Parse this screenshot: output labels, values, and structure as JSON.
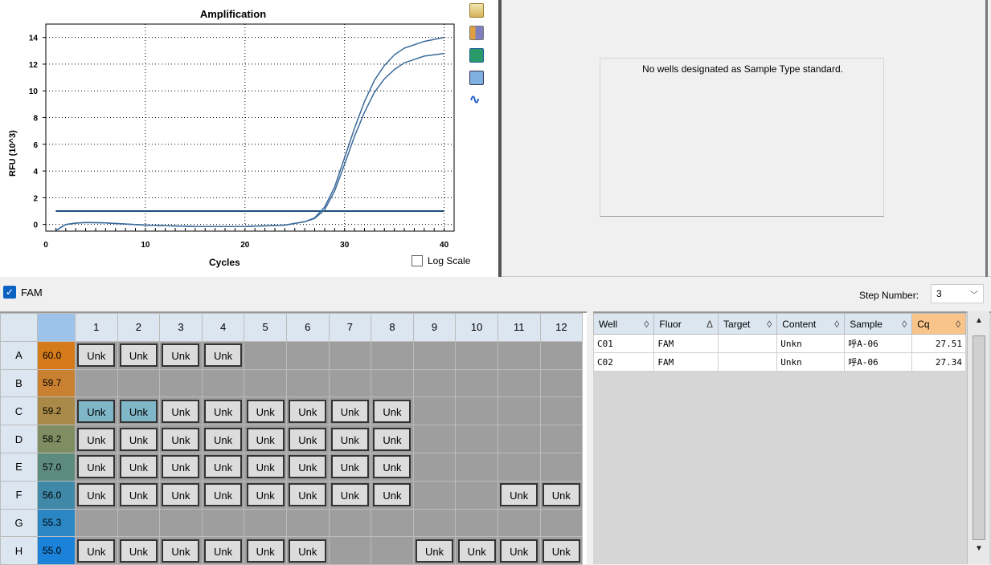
{
  "chart_data": {
    "type": "line",
    "title": "Amplification",
    "xlabel": "Cycles",
    "ylabel": "RFU (10^3)",
    "xlim": [
      0,
      41
    ],
    "ylim": [
      -0.5,
      15
    ],
    "xticks": [
      0,
      10,
      20,
      30,
      40
    ],
    "yticks": [
      0,
      2,
      4,
      6,
      8,
      10,
      12,
      14
    ],
    "grid": true,
    "threshold": 1.0,
    "series": [
      {
        "values": [
          [
            1,
            -0.45
          ],
          [
            2,
            0.0
          ],
          [
            3,
            0.1
          ],
          [
            4,
            0.15
          ],
          [
            6,
            0.12
          ],
          [
            10,
            -0.05
          ],
          [
            15,
            -0.15
          ],
          [
            20,
            -0.15
          ],
          [
            24,
            -0.05
          ],
          [
            26,
            0.2
          ],
          [
            27,
            0.5
          ],
          [
            28,
            1.3
          ],
          [
            29,
            2.8
          ],
          [
            30,
            5.0
          ],
          [
            31,
            7.2
          ],
          [
            32,
            9.2
          ],
          [
            33,
            10.8
          ],
          [
            34,
            11.9
          ],
          [
            35,
            12.7
          ],
          [
            36,
            13.2
          ],
          [
            38,
            13.7
          ],
          [
            40,
            14.0
          ]
        ]
      },
      {
        "values": [
          [
            1,
            -0.45
          ],
          [
            2,
            0.0
          ],
          [
            3,
            0.1
          ],
          [
            4,
            0.15
          ],
          [
            6,
            0.12
          ],
          [
            10,
            -0.05
          ],
          [
            15,
            -0.15
          ],
          [
            20,
            -0.15
          ],
          [
            24,
            -0.05
          ],
          [
            26,
            0.2
          ],
          [
            27,
            0.45
          ],
          [
            28,
            1.1
          ],
          [
            29,
            2.5
          ],
          [
            30,
            4.5
          ],
          [
            31,
            6.6
          ],
          [
            32,
            8.4
          ],
          [
            33,
            9.9
          ],
          [
            34,
            10.9
          ],
          [
            35,
            11.6
          ],
          [
            36,
            12.1
          ],
          [
            38,
            12.6
          ],
          [
            40,
            12.8
          ]
        ]
      }
    ],
    "line_color": "#3a6a9a",
    "threshold_color": "#1f4e79"
  },
  "right_panel": {
    "message": "No wells designated as Sample Type standard."
  },
  "log_scale_label": "Log Scale",
  "fluor_toggle": {
    "label": "FAM",
    "checked": true
  },
  "step": {
    "label": "Step Number:",
    "value": "3"
  },
  "plate": {
    "columns": [
      "1",
      "2",
      "3",
      "4",
      "5",
      "6",
      "7",
      "8",
      "9",
      "10",
      "11",
      "12"
    ],
    "rows": [
      {
        "label": "A",
        "temp": "60.0",
        "color": "#d57a1a",
        "wells": [
          "Unk",
          "Unk",
          "Unk",
          "Unk",
          "",
          "",
          "",
          "",
          "",
          "",
          "",
          ""
        ]
      },
      {
        "label": "B",
        "temp": "59.7",
        "color": "#c98030",
        "wells": [
          "",
          "",
          "",
          "",
          "",
          "",
          "",
          "",
          "",
          "",
          "",
          ""
        ]
      },
      {
        "label": "C",
        "temp": "59.2",
        "color": "#a98a48",
        "wells": [
          "Unk*",
          "Unk*",
          "Unk",
          "Unk",
          "Unk",
          "Unk",
          "Unk",
          "Unk",
          "",
          "",
          "",
          ""
        ]
      },
      {
        "label": "D",
        "temp": "58.2",
        "color": "#7e8d62",
        "wells": [
          "Unk",
          "Unk",
          "Unk",
          "Unk",
          "Unk",
          "Unk",
          "Unk",
          "Unk",
          "",
          "",
          "",
          ""
        ]
      },
      {
        "label": "E",
        "temp": "57.0",
        "color": "#5d8b7e",
        "wells": [
          "Unk",
          "Unk",
          "Unk",
          "Unk",
          "Unk",
          "Unk",
          "Unk",
          "Unk",
          "",
          "",
          "",
          ""
        ]
      },
      {
        "label": "F",
        "temp": "56.0",
        "color": "#3f88a8",
        "wells": [
          "Unk",
          "Unk",
          "Unk",
          "Unk",
          "Unk",
          "Unk",
          "Unk",
          "Unk",
          "",
          "",
          "Unk",
          "Unk"
        ]
      },
      {
        "label": "G",
        "temp": "55.3",
        "color": "#2b86c4",
        "wells": [
          "",
          "",
          "",
          "",
          "",
          "",
          "",
          "",
          "",
          "",
          "",
          ""
        ]
      },
      {
        "label": "H",
        "temp": "55.0",
        "color": "#1a82d8",
        "wells": [
          "Unk",
          "Unk",
          "Unk",
          "Unk",
          "Unk",
          "Unk",
          "",
          "",
          "Unk",
          "Unk",
          "Unk",
          "Unk"
        ]
      }
    ]
  },
  "results": {
    "headers": [
      "Well",
      "Fluor",
      "Target",
      "Content",
      "Sample",
      "Cq"
    ],
    "sort_icons": [
      "◊",
      "Δ",
      "◊",
      "◊",
      "◊",
      "◊"
    ],
    "rows": [
      [
        "C01",
        "FAM",
        "",
        "Unkn",
        "呼A-06",
        "27.51"
      ],
      [
        "C02",
        "FAM",
        "",
        "Unkn",
        "呼A-06",
        "27.34"
      ]
    ]
  }
}
